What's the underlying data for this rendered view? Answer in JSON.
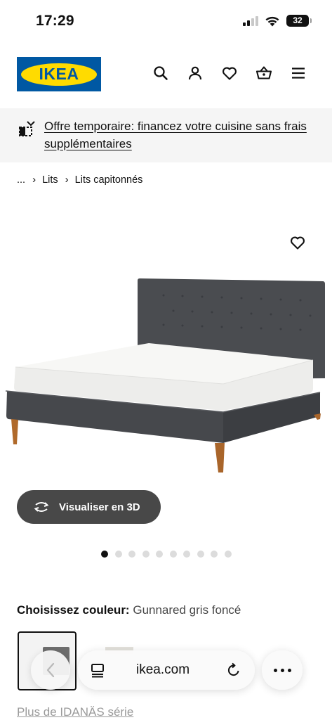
{
  "status_bar": {
    "time": "17:29",
    "battery": "32",
    "icons": [
      "signal-icon",
      "wifi-icon",
      "battery-icon"
    ]
  },
  "header": {
    "logo_text": "IKEA",
    "logo_colors": {
      "background": "#0058a3",
      "oval": "#ffdb00"
    },
    "icons": [
      "search-icon",
      "account-icon",
      "heart-icon",
      "basket-icon",
      "menu-icon"
    ]
  },
  "promo": {
    "text": "Offre temporaire: financez votre cuisine sans frais supplémentaires",
    "icon": "financing-icon"
  },
  "breadcrumb": [
    "...",
    "Lits",
    "Lits capitonnés"
  ],
  "product": {
    "image_icon": "bed-image",
    "favorite_icon": "heart-icon",
    "view3d_label": "Visualiser en 3D",
    "gallery": {
      "count": 10,
      "active_index": 0
    }
  },
  "color_chooser": {
    "label": "Choisissez couleur:",
    "value": "Gunnared gris foncé"
  },
  "series_link": "Plus de IDANÄS série",
  "browser": {
    "url": "ikea.com",
    "icons": [
      "back-icon",
      "tabs-icon",
      "reload-icon",
      "more-icon"
    ]
  }
}
